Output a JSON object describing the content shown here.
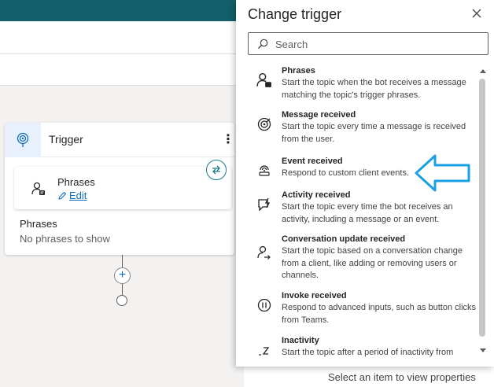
{
  "canvas": {
    "trigger_title": "Trigger",
    "phrases_title": "Phrases",
    "edit_label": "Edit",
    "phrases_label": "Phrases",
    "no_phrases": "No phrases to show"
  },
  "panel": {
    "title": "Change trigger",
    "search_placeholder": "Search",
    "items": [
      {
        "title": "Phrases",
        "desc": "Start the topic when the bot receives a message matching the topic's trigger phrases.",
        "icon": "phrases-icon"
      },
      {
        "title": "Message received",
        "desc": "Start the topic every time a message is received from the user.",
        "icon": "message-received-icon"
      },
      {
        "title": "Event received",
        "desc": "Respond to custom client events.",
        "icon": "event-received-icon"
      },
      {
        "title": "Activity received",
        "desc": "Start the topic every time the bot receives an activity, including a message or an event.",
        "icon": "activity-received-icon"
      },
      {
        "title": "Conversation update received",
        "desc": "Start the topic based on a conversation change from a client, like adding or removing users or channels.",
        "icon": "conversation-update-icon"
      },
      {
        "title": "Invoke received",
        "desc": "Respond to advanced inputs, such as button clicks from Teams.",
        "icon": "invoke-received-icon"
      },
      {
        "title": "Inactivity",
        "desc": "Start the topic after a period of inactivity from",
        "icon": "inactivity-icon"
      }
    ]
  },
  "properties": {
    "hint": "Select an item to view properties"
  },
  "colors": {
    "topbar": "#125f6b",
    "accent": "#0f6cbd",
    "callout_arrow": "#1ba1e2"
  }
}
